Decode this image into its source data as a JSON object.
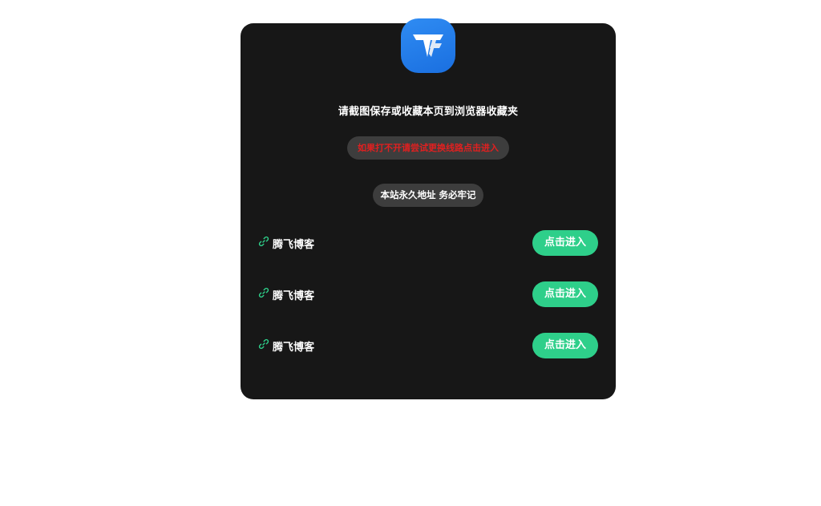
{
  "headline": "请截图保存或收藏本页到浏览器收藏夹",
  "warning_pill": "如果打不开请尝试更换线路点击进入",
  "info_pill": "本站永久地址 务必牢记",
  "logo_icon": "tf-logo-icon",
  "accent_green": "#2ecf8a",
  "warning_red": "#e02020",
  "links": [
    {
      "name": "腾飞博客",
      "button": "点击进入",
      "icon": "link-icon"
    },
    {
      "name": "腾飞博客",
      "button": "点击进入",
      "icon": "link-icon"
    },
    {
      "name": "腾飞博客",
      "button": "点击进入",
      "icon": "link-icon"
    }
  ]
}
